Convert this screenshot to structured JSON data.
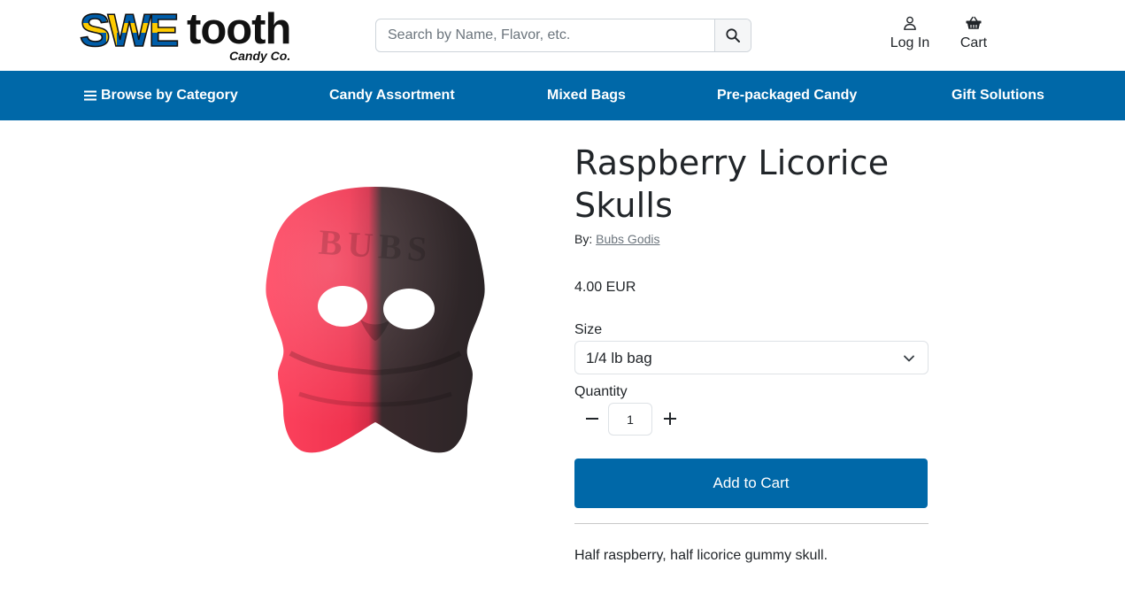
{
  "brand": {
    "logo_main": "tooth",
    "logo_prefix": "SWE",
    "logo_sub": "Candy Co.",
    "colors": {
      "blue": "#005da8",
      "yellow": "#fecb00"
    }
  },
  "search": {
    "placeholder": "Search by Name, Flavor, etc.",
    "value": "",
    "icon": "search-icon"
  },
  "header_links": {
    "login_label": "Log In",
    "login_icon": "user-icon",
    "cart_label": "Cart",
    "cart_icon": "basket-icon"
  },
  "nav": {
    "background": "#0068a8",
    "items": [
      {
        "label": "Browse by Category",
        "icon": "menu-icon"
      },
      {
        "label": "Candy Assortment"
      },
      {
        "label": "Mixed Bags"
      },
      {
        "label": "Pre-packaged Candy"
      },
      {
        "label": "Gift Solutions"
      }
    ]
  },
  "product": {
    "title": "Raspberry Licorice Skulls",
    "by_prefix": "By:",
    "brand": "Bubs Godis",
    "price": "4.00 EUR",
    "size_label": "Size",
    "size_value": "1/4 lb bag",
    "quantity_label": "Quantity",
    "quantity": "1",
    "add_to_cart": "Add to Cart",
    "description": "Half raspberry, half licorice gummy skull.",
    "image": {
      "embossed_text": "BUBS",
      "colors": {
        "raspberry": "#f0334f",
        "licorice": "#2d2628"
      }
    }
  }
}
